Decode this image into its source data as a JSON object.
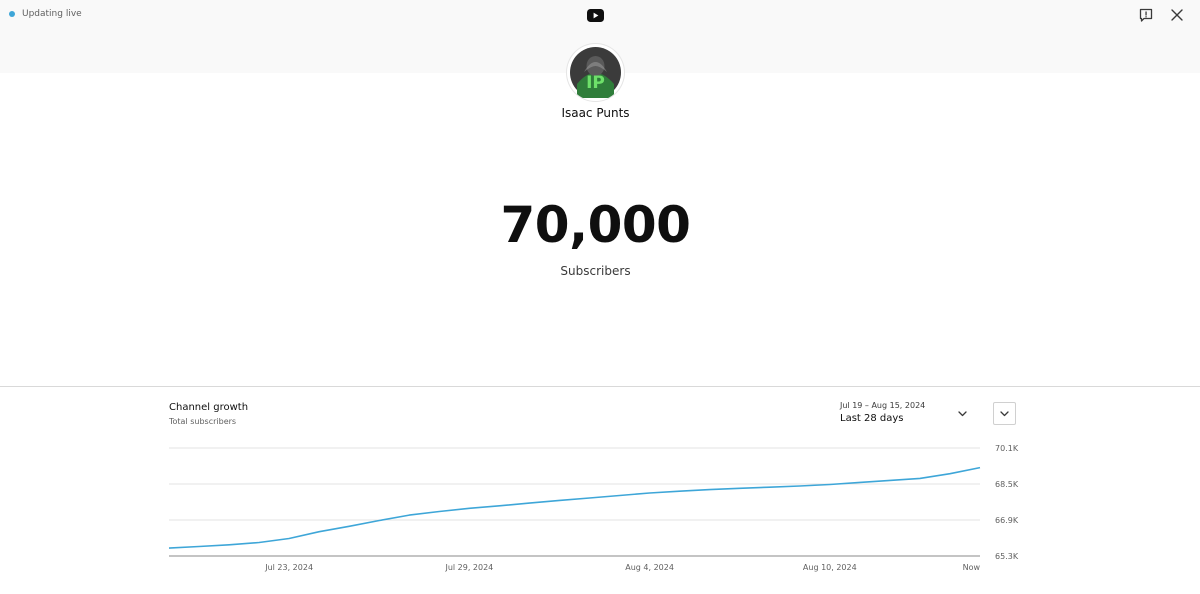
{
  "header": {
    "status_text": "Updating live",
    "status_color": "#3ea6d8",
    "logo_icon": "youtube-logo-icon",
    "feedback_icon": "feedback-icon",
    "close_icon": "close-icon"
  },
  "channel": {
    "name": "Isaac Punts",
    "avatar_icon": "channel-avatar"
  },
  "counter": {
    "value": "70,000",
    "label": "Subscribers"
  },
  "growth": {
    "title": "Channel growth",
    "subtitle": "Total subscribers",
    "date_range": "Jul 19 – Aug 15, 2024",
    "range_label": "Last 28 days",
    "accent_color": "#3ea6d8"
  },
  "chart_data": {
    "type": "line",
    "title": "Channel growth",
    "subtitle": "Total subscribers",
    "x_tick_labels": [
      "Jul 23, 2024",
      "Jul 29, 2024",
      "Aug 4, 2024",
      "Aug 10, 2024",
      "Now"
    ],
    "y_tick_labels": [
      "70.1K",
      "68.5K",
      "66.9K",
      "65.3K"
    ],
    "y_ticks": [
      70100,
      68500,
      66900,
      65300
    ],
    "ylim": [
      65300,
      70100
    ],
    "grid": true,
    "series": [
      {
        "color": "#3ea6d8",
        "x": [
          "2024-07-19",
          "2024-07-20",
          "2024-07-21",
          "2024-07-22",
          "2024-07-23",
          "2024-07-24",
          "2024-07-25",
          "2024-07-26",
          "2024-07-27",
          "2024-07-28",
          "2024-07-29",
          "2024-07-30",
          "2024-07-31",
          "2024-08-01",
          "2024-08-02",
          "2024-08-03",
          "2024-08-04",
          "2024-08-05",
          "2024-08-06",
          "2024-08-07",
          "2024-08-08",
          "2024-08-09",
          "2024-08-10",
          "2024-08-11",
          "2024-08-12",
          "2024-08-13",
          "2024-08-14",
          "2024-08-15"
        ],
        "values": [
          65650,
          65720,
          65800,
          65900,
          66080,
          66380,
          66620,
          66880,
          67120,
          67280,
          67420,
          67530,
          67650,
          67770,
          67880,
          67990,
          68100,
          68180,
          68250,
          68310,
          68360,
          68410,
          68480,
          68570,
          68660,
          68750,
          68960,
          69230
        ]
      }
    ]
  }
}
